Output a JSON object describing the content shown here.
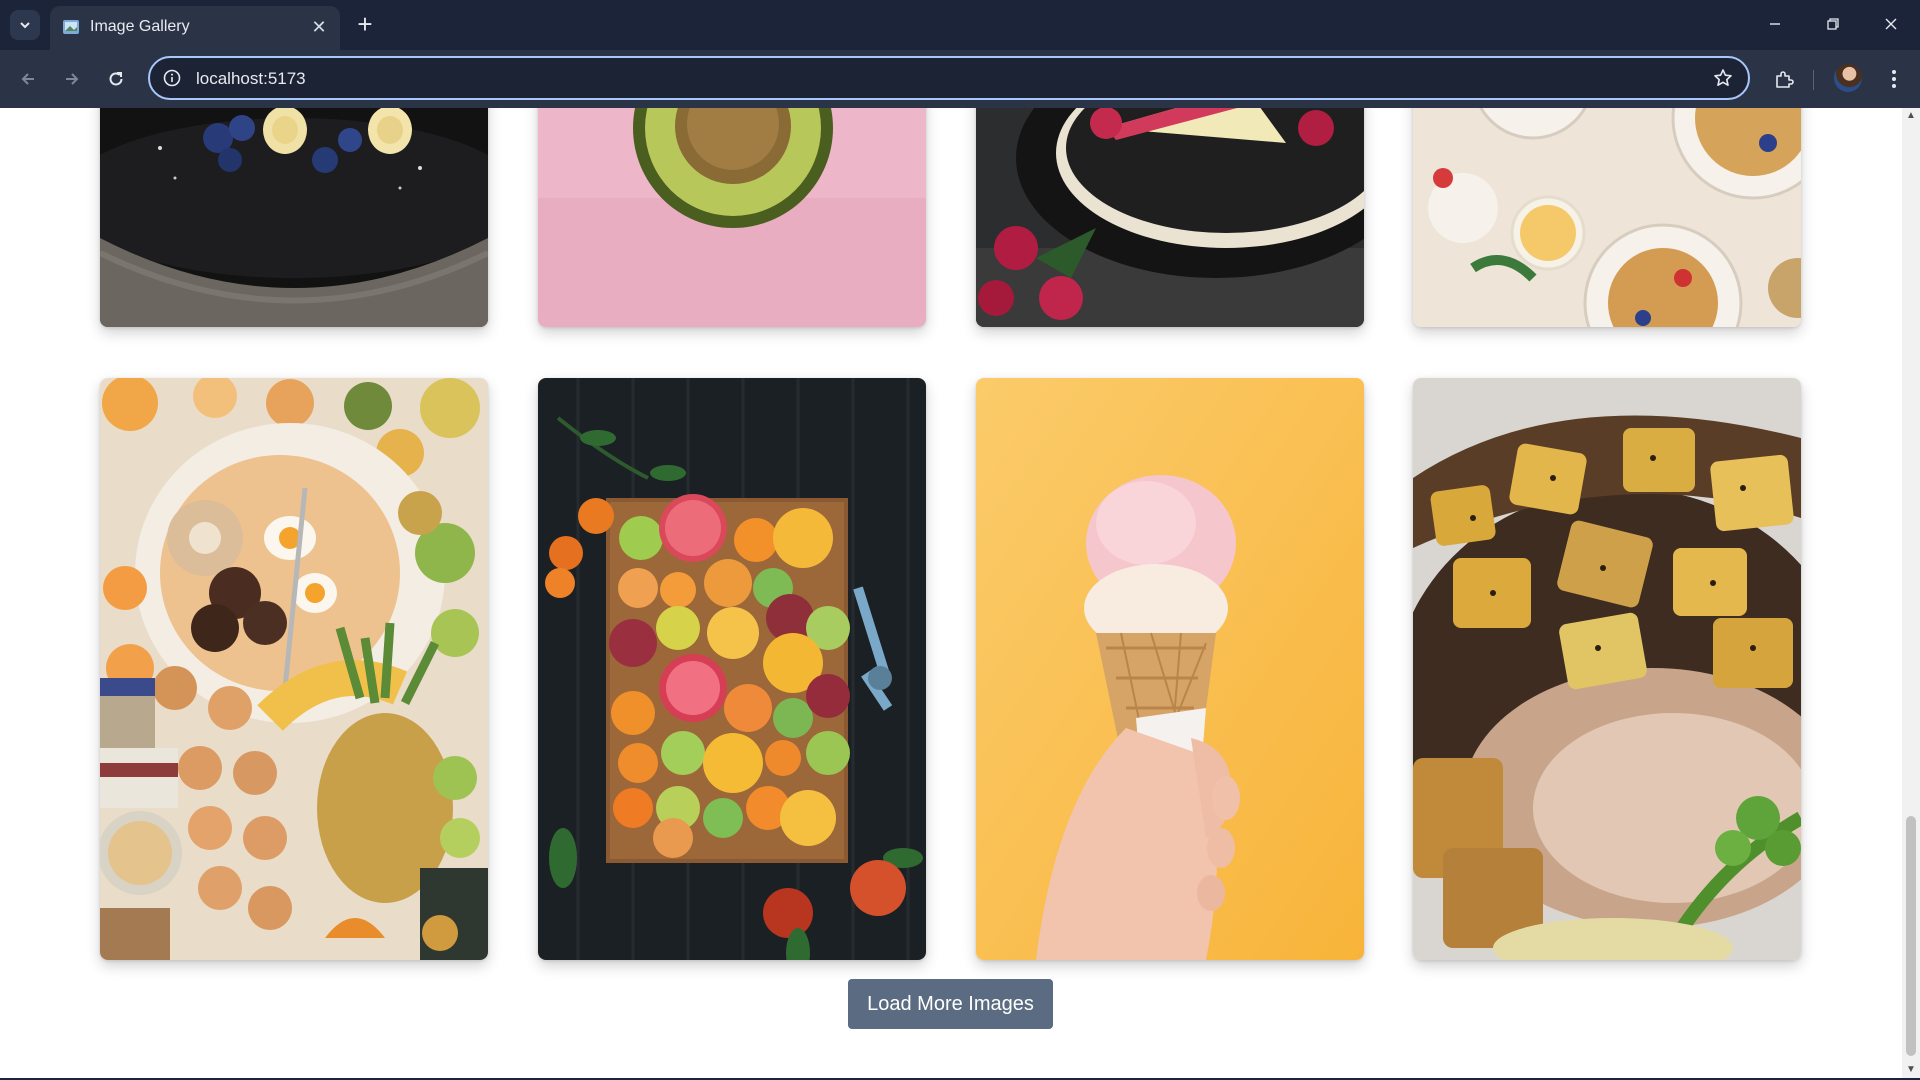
{
  "browser": {
    "tab_title": "Image Gallery",
    "url": "localhost:5173",
    "icons": {
      "tab_list": "chevron-down-icon",
      "favicon": "image-icon",
      "close_tab": "close-icon",
      "new_tab": "plus-icon",
      "back": "arrow-left-icon",
      "forward": "arrow-right-icon",
      "reload": "reload-icon",
      "site_info": "info-icon",
      "bookmark": "star-icon",
      "extensions": "puzzle-icon",
      "profile": "avatar",
      "menu": "more-vertical-icon",
      "minimize": "minimize-icon",
      "restore": "restore-icon",
      "close_window": "close-icon"
    }
  },
  "gallery": {
    "images": [
      {
        "subject": "blueberries-and-banana-dessert"
      },
      {
        "subject": "avocado-on-pink"
      },
      {
        "subject": "raspberry-cake"
      },
      {
        "subject": "waffles-and-fruit-breakfast"
      },
      {
        "subject": "breakfast-plate-with-fruits"
      },
      {
        "subject": "citrus-slices-on-board"
      },
      {
        "subject": "ice-cream-cone"
      },
      {
        "subject": "roasted-chicken-with-potatoes"
      }
    ],
    "load_more_label": "Load More Images"
  },
  "colors": {
    "chrome_dark": "#1b2438",
    "chrome_toolbar": "#2b3447",
    "omnibox_focus": "#a8c7fa",
    "button_bg": "#5b6b82",
    "page_bg": "#ffffff"
  }
}
